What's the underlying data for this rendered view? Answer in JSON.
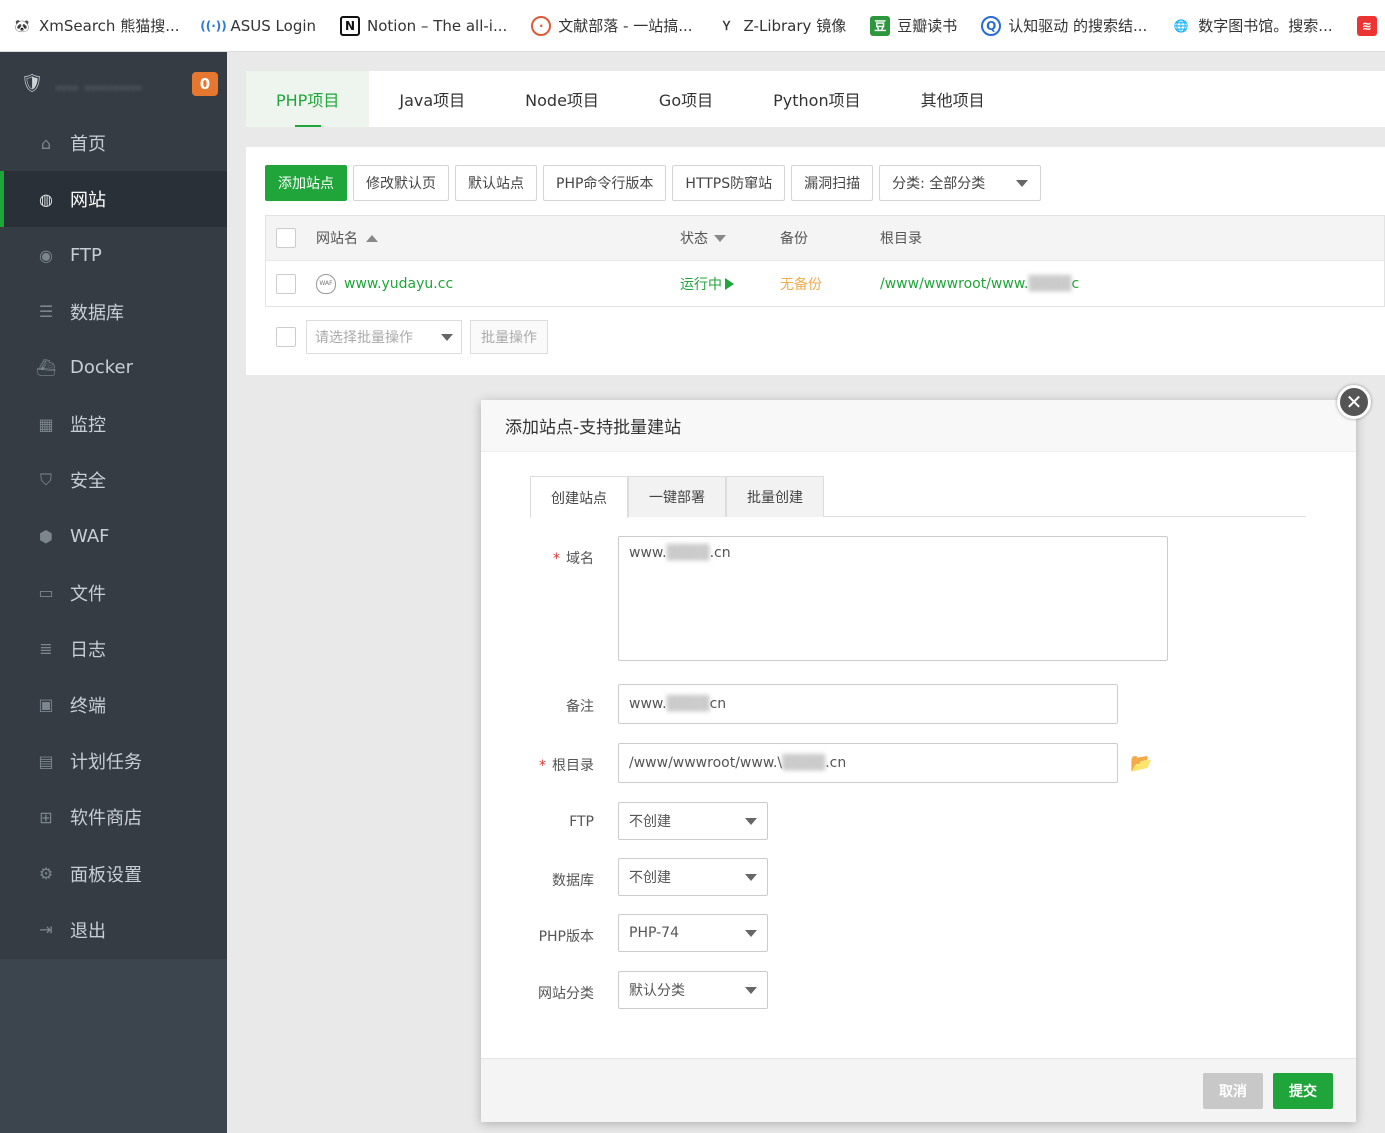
{
  "bookmarks": [
    {
      "icon": "panda-icon",
      "label": "XmSearch 熊猫搜..."
    },
    {
      "icon": "router-icon",
      "label": "ASUS Login"
    },
    {
      "icon": "notion-icon",
      "label": "Notion – The all-i..."
    },
    {
      "icon": "target-icon",
      "label": "文献部落 - 一站搞..."
    },
    {
      "icon": "z-library-icon",
      "label": "Z-Library 镜像"
    },
    {
      "icon": "douban-icon",
      "label": "豆瓣读书"
    },
    {
      "icon": "search-icon",
      "label": "认知驱动 的搜索结..."
    },
    {
      "icon": "globe-icon",
      "label": "数字图书馆。搜索..."
    }
  ],
  "sidebar": {
    "server_name": "....  ..........",
    "notification_count": "0",
    "items": [
      {
        "icon": "home-icon",
        "label": "首页"
      },
      {
        "icon": "globe-icon",
        "label": "网站"
      },
      {
        "icon": "ftp-icon",
        "label": "FTP"
      },
      {
        "icon": "database-icon",
        "label": "数据库"
      },
      {
        "icon": "docker-icon",
        "label": "Docker"
      },
      {
        "icon": "monitor-icon",
        "label": "监控"
      },
      {
        "icon": "shield-icon",
        "label": "安全"
      },
      {
        "icon": "waf-icon",
        "label": "WAF"
      },
      {
        "icon": "folder-icon",
        "label": "文件"
      },
      {
        "icon": "log-icon",
        "label": "日志"
      },
      {
        "icon": "terminal-icon",
        "label": "终端"
      },
      {
        "icon": "calendar-icon",
        "label": "计划任务"
      },
      {
        "icon": "apps-icon",
        "label": "软件商店"
      },
      {
        "icon": "gear-icon",
        "label": "面板设置"
      },
      {
        "icon": "logout-icon",
        "label": "退出"
      }
    ]
  },
  "project_tabs": [
    "PHP项目",
    "Java项目",
    "Node项目",
    "Go项目",
    "Python项目",
    "其他项目"
  ],
  "toolbar": {
    "add_site": "添加站点",
    "edit_default_page": "修改默认页",
    "default_site": "默认站点",
    "php_cli_version": "PHP命令行版本",
    "https_protection": "HTTPS防窜站",
    "vuln_scan": "漏洞扫描",
    "category_filter": "分类: 全部分类"
  },
  "table": {
    "headers": {
      "name": "网站名",
      "status": "状态",
      "backup": "备份",
      "root": "根目录"
    },
    "rows": [
      {
        "name": "www.yudayu.cc",
        "status": "运行中",
        "backup": "无备份",
        "root_visible": "/www/wwwroot/www.",
        "root_tail": "c"
      }
    ]
  },
  "batch": {
    "placeholder": "请选择批量操作",
    "button": "批量操作"
  },
  "modal": {
    "title": "添加站点-支持批量建站",
    "tabs": [
      "创建站点",
      "一键部署",
      "批量创建"
    ],
    "fields": {
      "domain_label": "域名",
      "domain_prefix": "www.",
      "domain_suffix": ".cn",
      "remark_label": "备注",
      "remark_prefix": "www.",
      "remark_suffix": "cn",
      "root_label": "根目录",
      "root_prefix": "/www/wwwroot/www.\\",
      "root_suffix": ".cn",
      "ftp_label": "FTP",
      "ftp_value": "不创建",
      "db_label": "数据库",
      "db_value": "不创建",
      "php_label": "PHP版本",
      "php_value": "PHP-74",
      "category_label": "网站分类",
      "category_value": "默认分类"
    },
    "cancel": "取消",
    "submit": "提交"
  },
  "colors": {
    "accent": "#20a53a",
    "sidebar": "#3c444d",
    "badge": "#e6772e",
    "warning": "#f0ad4e"
  }
}
